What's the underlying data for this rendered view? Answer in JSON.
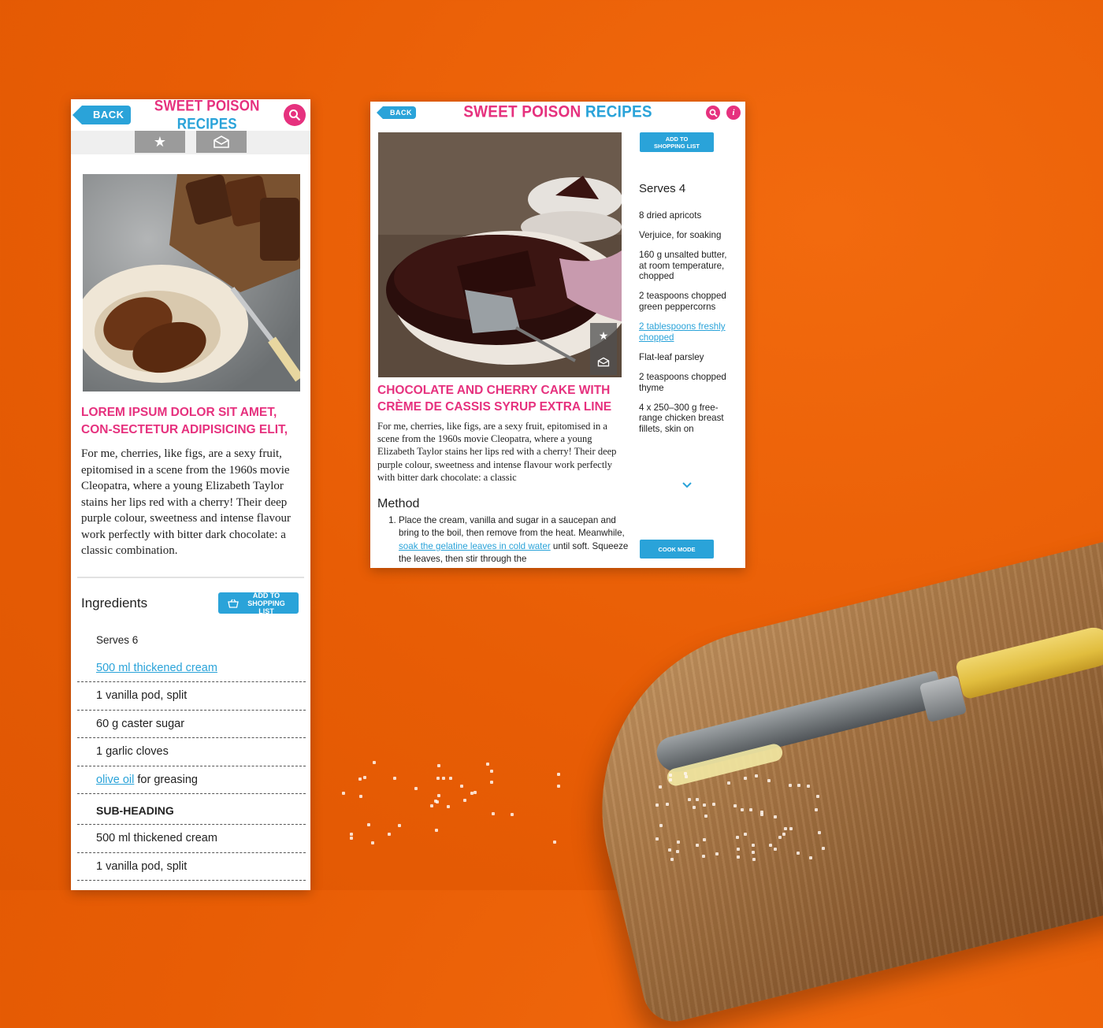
{
  "brand": {
    "part1": "SWEET POISON",
    "part2": "RECIPES"
  },
  "phone": {
    "back_label": "BACK",
    "title": "LOREM IPSUM DOLOR SIT AMET, CON-SECTETUR ADIPISICING ELIT,",
    "body": "For me, cherries, like figs, are a sexy fruit, epitomised in a scene from the 1960s movie Cleopatra, where a young Elizabeth Taylor stains her lips red with a cherry! Their deep purple colour, sweetness and intense flavour work perfectly with bitter dark chocolate: a classic combination.",
    "ingredients_heading": "Ingredients",
    "add_btn": "ADD TO SHOPPING LIST",
    "serves": "Serves 6",
    "items": [
      {
        "link": "500 ml thickened cream",
        "rest": ""
      },
      {
        "link": "",
        "rest": "1 vanilla pod, split"
      },
      {
        "link": "",
        "rest": "60 g caster sugar"
      },
      {
        "link": "",
        "rest": "1 garlic cloves"
      },
      {
        "link": "olive oil",
        "rest": " for greasing"
      }
    ],
    "sub_heading": "SUB-HEADING",
    "sub_items": [
      "500 ml thickened cream",
      "1 vanilla pod, split"
    ]
  },
  "tablet": {
    "back_label": "BACK",
    "title": "CHOCOLATE AND CHERRY CAKE WITH CRÈME DE CASSIS SYRUP EXTRA LINE",
    "body": "For me, cherries, like figs, are a sexy fruit, epitomised in a scene from the 1960s movie Cleopatra, where a young Elizabeth Taylor stains her lips red with a cherry! Their deep purple colour, sweetness and intense flavour work perfectly with bitter dark chocolate: a classic",
    "method_heading": "Method",
    "method_step_1a": "Place the cream, vanilla and sugar in a saucepan and bring to the boil, then remove from the heat. Meanwhile, ",
    "method_step_1_link": "soak the gelatine leaves in cold water",
    "method_step_1b": " until soft. Squeeze the leaves, then stir through the",
    "add_btn": "ADD TO SHOPPING LIST",
    "serves": "Serves 4",
    "ingredients": [
      "8 dried apricots",
      "Verjuice, for soaking",
      "160 g unsalted butter, at room temperature, chopped",
      "2 teaspoons chopped green peppercorns",
      "2 tablespoons freshly chopped",
      "Flat-leaf parsley",
      "2 teaspoons chopped thyme",
      "4 x 250–300 g free-range chicken breast fillets, skin on"
    ],
    "cook_mode": "COOK MODE"
  },
  "colors": {
    "pink": "#e6317e",
    "blue": "#2aa3d9",
    "orange": "#e85d05"
  }
}
